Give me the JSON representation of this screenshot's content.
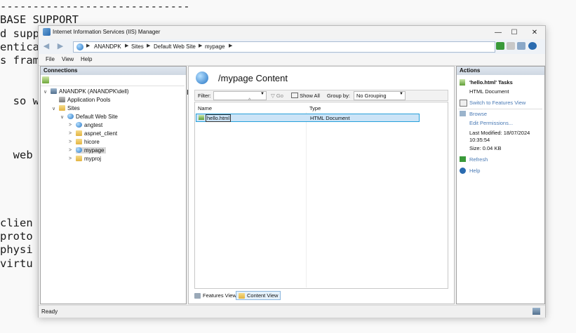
{
  "background_text": {
    "lines": [
      "-----------------------------",
      "BASE SUPPORT",
      "d supp",
      "entica",
      "s fram",
      "",
      "",
      "  so we",
      "",
      "",
      "",
      "  web s",
      "",
      "",
      "",
      "",
      "clien",
      "proto",
      "physi",
      "virtu"
    ]
  },
  "window": {
    "title": "Internet Information Services (IIS) Manager",
    "minimize": "—",
    "maximize": "☐",
    "close": "✕"
  },
  "address": {
    "crumbs": [
      "ANANDPK",
      "Sites",
      "Default Web Site",
      "mypage"
    ],
    "separator": "▶"
  },
  "menu": {
    "file": "File",
    "view": "View",
    "help": "Help"
  },
  "connections": {
    "header": "Connections",
    "server": "ANANDPK (ANANDPK\\dell)",
    "app_pools": "Application Pools",
    "sites": "Sites",
    "default_site": "Default Web Site",
    "children": [
      "angtest",
      "aspnet_client",
      "hicore",
      "mypage",
      "myproj"
    ]
  },
  "content": {
    "title": "/mypage Content",
    "filter_label": "Filter:",
    "go_label": "Go",
    "show_all_label": "Show All",
    "group_by_label": "Group by:",
    "group_by_value": "No Grouping",
    "columns": {
      "name": "Name",
      "type": "Type"
    },
    "rows": [
      {
        "name": "hello.html",
        "type": "HTML Document"
      }
    ],
    "features_view": "Features View",
    "content_view": "Content View"
  },
  "actions": {
    "header": "Actions",
    "task_title": "'hello.html' Tasks",
    "task_sub": "HTML Document",
    "switch": "Switch to Features View",
    "browse": "Browse",
    "edit_permissions": "Edit Permissions...",
    "last_modified_label": "Last Modified: 18/07/2024",
    "last_modified_time": "10:35:54",
    "size": "Size: 0.04 KB",
    "refresh": "Refresh",
    "help": "Help"
  },
  "status": {
    "text": "Ready"
  },
  "colors": {
    "link": "#4a7ab5",
    "selection": "#cce4f7",
    "selection_border": "#26a0da"
  }
}
